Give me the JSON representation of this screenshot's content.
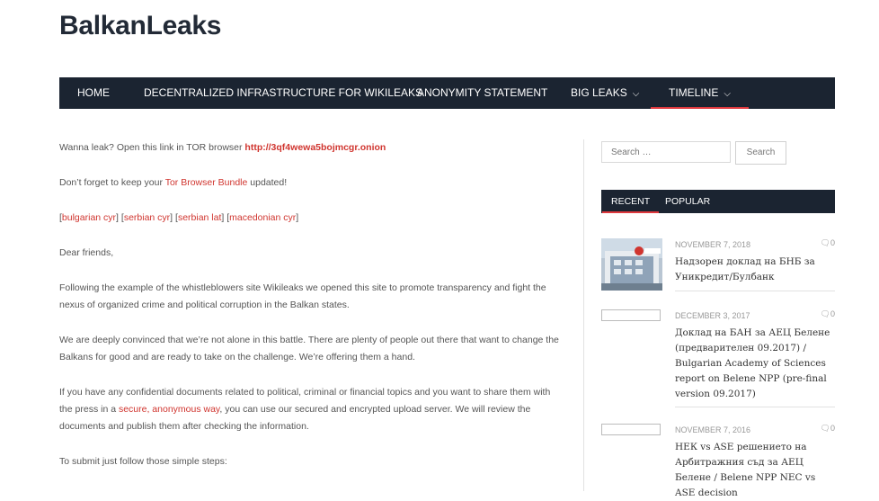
{
  "site": {
    "title": "BalkanLeaks"
  },
  "nav": {
    "items": [
      {
        "label": "HOME"
      },
      {
        "label": "DECENTRALIZED INFRASTRUCTURE FOR WIKILEAKS"
      },
      {
        "label": "ANONYMITY STATEMENT"
      },
      {
        "label": "BIG LEAKS"
      },
      {
        "label": "TIMELINE"
      }
    ],
    "active": "TIMELINE"
  },
  "content": {
    "p1_text": "Wanna leak? Open this link in TOR browser ",
    "p1_link": "http://3qf4wewa5bojmcgr.onion",
    "p2_pre": "Don’t forget to keep your ",
    "p2_link": "Tor Browser Bundle",
    "p2_post": " updated!",
    "langs": [
      "bulgarian cyr",
      "serbian cyr",
      "serbian lat",
      "macedonian cyr"
    ],
    "greeting": "Dear friends,",
    "p4": "Following the example of the whistleblowers site Wikileaks we opened this site to promote transparency and fight the nexus of organized crime and political corruption in the Balkan states.",
    "p5": "We are deeply convinced that we’re not alone in this battle. There are plenty of people out there that want to change the Balkans for good and are ready to take on the challenge. We’re offering them a hand.",
    "p6_pre": "If you have any confidential documents related to political, criminal or financial topics and you want to share them with the press in a ",
    "p6_link": "secure, anonymous way",
    "p6_post": ", you can use our secured and encrypted upload server. We will review the documents and publish them after checking the information.",
    "p7": "To submit just follow those simple steps:"
  },
  "sidebar": {
    "search": {
      "placeholder": "Search …",
      "button": "Search"
    },
    "tabs": [
      {
        "label": "RECENT"
      },
      {
        "label": "POPULAR"
      }
    ],
    "posts": [
      {
        "date": "NOVEMBER 7, 2018",
        "comments": "0",
        "title": "Надзорен доклад на БНБ за Уникредит/Булбанк"
      },
      {
        "date": "DECEMBER 3, 2017",
        "comments": "0",
        "title": "Доклад на БАН за АЕЦ Белене (предварителен 09.2017) / Bulgarian Academy of Sciences report on Belene NPP (pre-final version 09.2017)"
      },
      {
        "date": "NOVEMBER 7, 2016",
        "comments": "0",
        "title": "НЕК vs ASE решението на Арбитражния съд за АЕЦ Белене / Belene NPP NEC vs ASE decision"
      }
    ]
  },
  "colors": {
    "nav_bg": "#1b2431",
    "accent": "#e0393e",
    "link": "#d0352f"
  },
  "icons": {
    "chevron": "chevron-down-icon",
    "comment": "comment-icon"
  }
}
